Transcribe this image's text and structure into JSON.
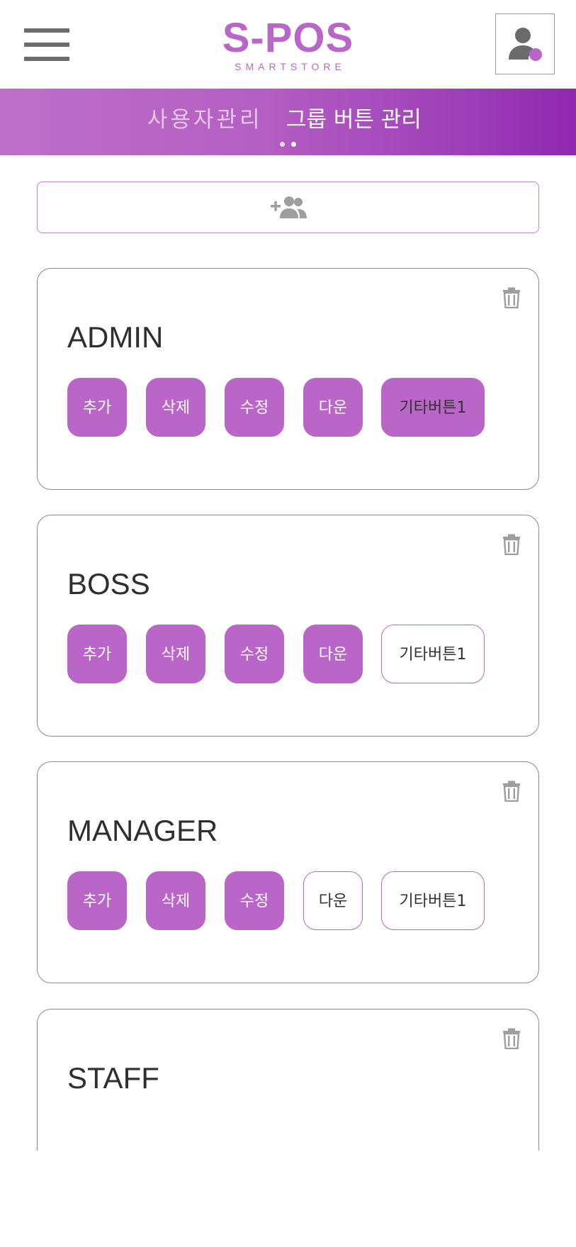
{
  "header": {
    "logo_main": "S-POS",
    "logo_sub": "SMARTSTORE"
  },
  "tabs": [
    {
      "label": "사용자관리",
      "active": false
    },
    {
      "label": "그룹 버튼 관리",
      "active": true
    }
  ],
  "colors": {
    "accent": "#b966c8",
    "tab_gradient_start": "#bd70c9",
    "tab_gradient_end": "#8f28b0",
    "icon_gray": "#9e9e9e"
  },
  "icons": {
    "menu": "hamburger-icon",
    "profile": "user-icon",
    "add_group": "add-group-icon",
    "delete": "trash-icon"
  },
  "groups": [
    {
      "name": "ADMIN",
      "buttons": [
        {
          "label": "추가",
          "enabled": true
        },
        {
          "label": "삭제",
          "enabled": true
        },
        {
          "label": "수정",
          "enabled": true
        },
        {
          "label": "다운",
          "enabled": true
        },
        {
          "label": "기타버튼1",
          "enabled": true
        }
      ]
    },
    {
      "name": "BOSS",
      "buttons": [
        {
          "label": "추가",
          "enabled": true
        },
        {
          "label": "삭제",
          "enabled": true
        },
        {
          "label": "수정",
          "enabled": true
        },
        {
          "label": "다운",
          "enabled": true
        },
        {
          "label": "기타버튼1",
          "enabled": false
        }
      ]
    },
    {
      "name": "MANAGER",
      "buttons": [
        {
          "label": "추가",
          "enabled": true
        },
        {
          "label": "삭제",
          "enabled": true
        },
        {
          "label": "수정",
          "enabled": true
        },
        {
          "label": "다운",
          "enabled": false
        },
        {
          "label": "기타버튼1",
          "enabled": false
        }
      ]
    },
    {
      "name": "STAFF"
    }
  ]
}
